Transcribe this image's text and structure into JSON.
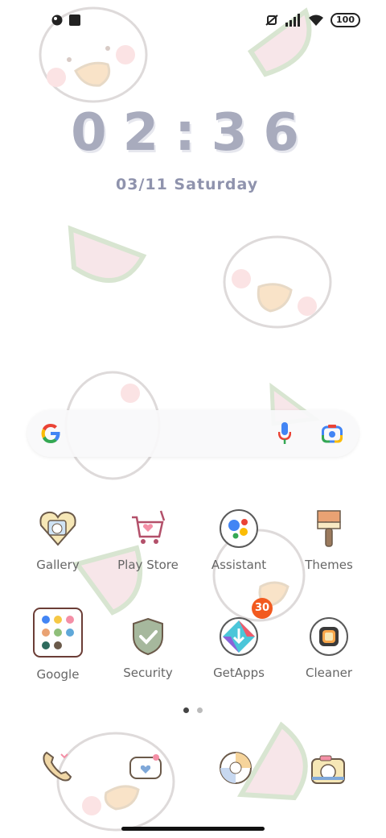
{
  "status_bar": {
    "battery": "100",
    "icons": [
      "notification-icon",
      "square-icon",
      "mute-icon",
      "signal-icon",
      "wifi-icon",
      "battery-icon"
    ]
  },
  "lock": {
    "time": "02:36",
    "date": "03/11 Saturday"
  },
  "search": {
    "icons": [
      "google-logo",
      "mic-icon",
      "lens-icon"
    ]
  },
  "apps_row1": [
    {
      "label": "Gallery"
    },
    {
      "label": "Play Store"
    },
    {
      "label": "Assistant"
    },
    {
      "label": "Themes"
    }
  ],
  "apps_row2": [
    {
      "label": "Google"
    },
    {
      "label": "Security"
    },
    {
      "label": "GetApps",
      "badge": "30"
    },
    {
      "label": "Cleaner"
    }
  ],
  "page_indicator": {
    "pages": 2,
    "active": 1
  },
  "dock": [
    "phone-icon",
    "messages-icon",
    "browser-icon",
    "camera-icon"
  ],
  "colors": {
    "clock": "#a8abbd",
    "badge": "#f25a1f",
    "wallpaper_pink": "#f4d9dc",
    "wallpaper_green": "#d9e6d3"
  }
}
